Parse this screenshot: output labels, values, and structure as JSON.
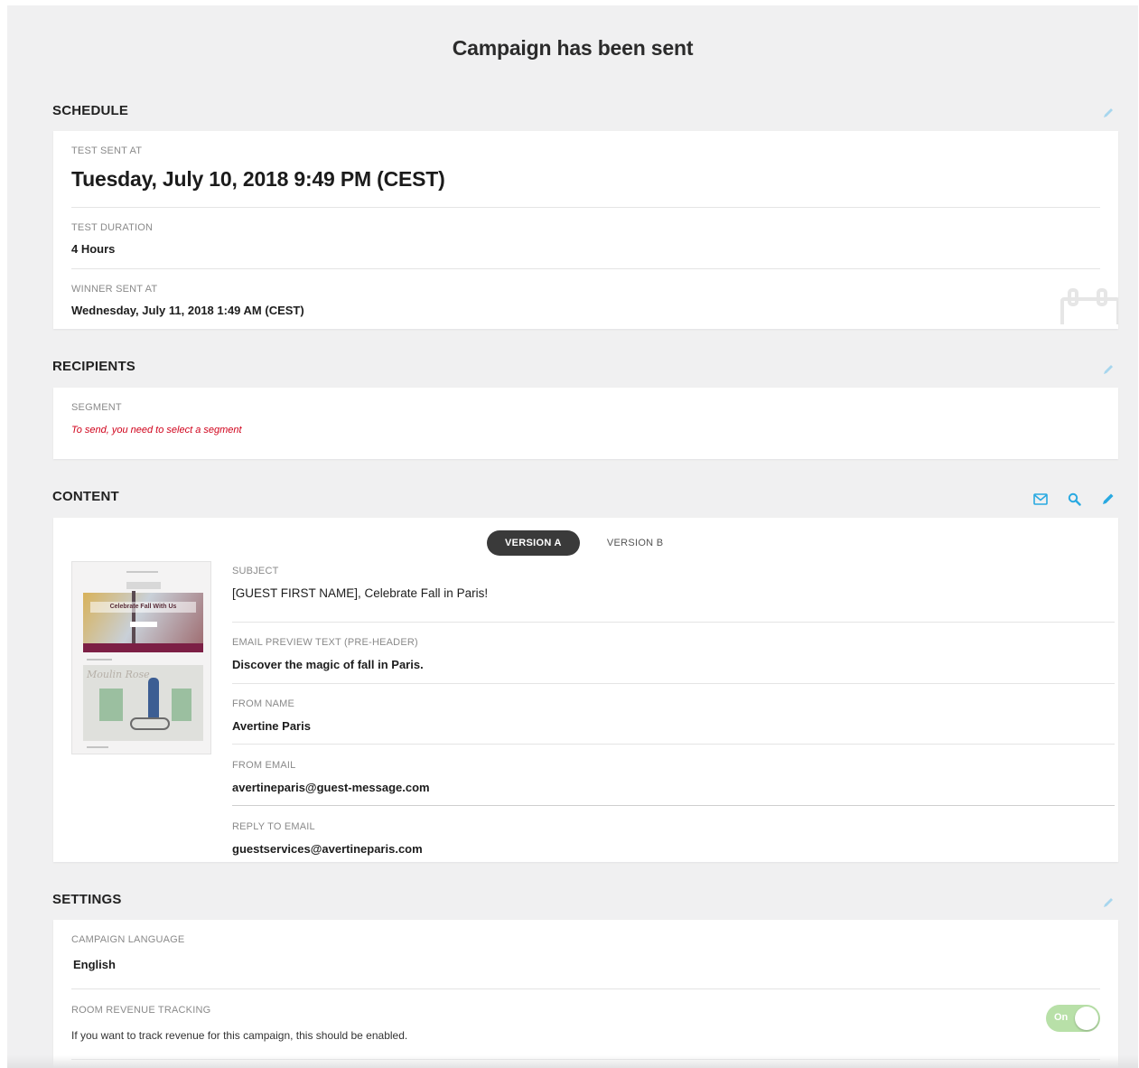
{
  "page": {
    "title": "Campaign has been sent"
  },
  "schedule": {
    "heading": "SCHEDULE",
    "test_sent_label": "TEST SENT AT",
    "test_sent_value": "Tuesday, July 10, 2018 9:49 PM (CEST)",
    "duration_label": "TEST DURATION",
    "duration_value": "4 Hours",
    "winner_label": "WINNER SENT AT",
    "winner_value": "Wednesday, July 11, 2018 1:49 AM (CEST)"
  },
  "recipients": {
    "heading": "RECIPIENTS",
    "segment_label": "SEGMENT",
    "segment_error": "To send, you need to select a segment"
  },
  "content": {
    "heading": "CONTENT",
    "tabs": {
      "active": "VERSION A",
      "inactive": "VERSION B"
    },
    "fields": [
      {
        "label": "SUBJECT",
        "value": "[GUEST FIRST NAME], Celebrate Fall in Paris!"
      },
      {
        "label": "EMAIL PREVIEW TEXT (PRE-HEADER)",
        "value": "Discover the magic of fall in Paris."
      },
      {
        "label": "FROM NAME",
        "value": "Avertine Paris"
      },
      {
        "label": "FROM EMAIL",
        "value": "avertineparis@guest-message.com"
      },
      {
        "label": "REPLY TO EMAIL",
        "value": "guestservices@avertineparis.com"
      }
    ],
    "thumbnail": {
      "banner_text": "Celebrate Fall With Us",
      "script_text": "Moulin Rose"
    }
  },
  "settings": {
    "heading": "SETTINGS",
    "language_label": "CAMPAIGN LANGUAGE",
    "language_value": "English",
    "revenue_label": "ROOM REVENUE TRACKING",
    "revenue_help": "If you want to track revenue for this campaign, this should be enabled.",
    "toggle_label": "On",
    "toggle_state": true
  },
  "icons": {
    "edit": "pencil-icon",
    "email": "envelope-icon",
    "preview": "search-icon",
    "calendar": "calendar-icon"
  },
  "colors": {
    "accent": "#29a9e1",
    "error": "#d0021b",
    "toggle_on": "#b8e0a8",
    "tab_active": "#3a3a3a"
  }
}
